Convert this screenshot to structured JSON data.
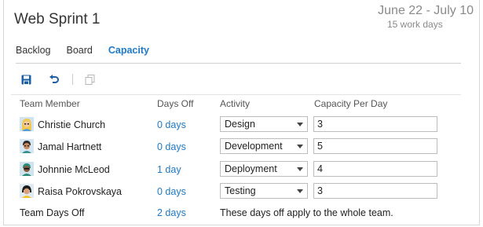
{
  "header": {
    "title": "Web Sprint 1",
    "dates": "June 22 - July 10",
    "work_days": "15 work days"
  },
  "tabs": [
    "Backlog",
    "Board",
    "Capacity"
  ],
  "toolbar": {
    "icons": [
      "save-icon",
      "undo-icon",
      "copy-icon"
    ]
  },
  "columns": {
    "member": "Team Member",
    "days_off": "Days Off",
    "activity": "Activity",
    "capacity": "Capacity Per Day"
  },
  "members": [
    {
      "name": "Christie Church",
      "days_off": "0 days",
      "activity": "Design",
      "capacity": "3"
    },
    {
      "name": "Jamal Hartnett",
      "days_off": "0 days",
      "activity": "Development",
      "capacity": "5"
    },
    {
      "name": "Johnnie McLeod",
      "days_off": "1 day",
      "activity": "Deployment",
      "capacity": "4"
    },
    {
      "name": "Raisa Pokrovskaya",
      "days_off": "0 days",
      "activity": "Testing",
      "capacity": "3"
    }
  ],
  "footer": {
    "label": "Team Days Off",
    "days": "2 days",
    "note": "These days off apply to the whole team."
  },
  "colors": {
    "accent": "#1e7ac7",
    "muted": "#8a8a8a"
  }
}
